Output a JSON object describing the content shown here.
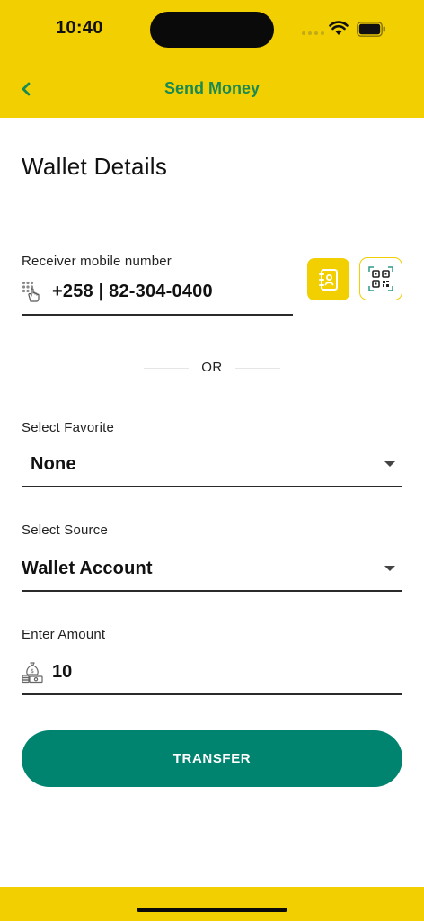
{
  "status_bar": {
    "time": "10:40"
  },
  "header": {
    "title": "Send Money",
    "back_icon": "chevron-left-icon"
  },
  "page": {
    "title": "Wallet Details"
  },
  "receiver": {
    "label": "Receiver mobile number",
    "value": "+258 | 82-304-0400",
    "contacts_icon": "contacts-book-icon",
    "qr_icon": "qr-scan-icon"
  },
  "divider": {
    "text": "OR"
  },
  "favorite": {
    "label": "Select Favorite",
    "value": "None"
  },
  "source": {
    "label": "Select Source",
    "value": "Wallet Account"
  },
  "amount": {
    "label": "Enter Amount",
    "value": "10"
  },
  "actions": {
    "transfer_label": "TRANSFER"
  },
  "colors": {
    "brand_yellow": "#f2cf00",
    "brand_green": "#008470",
    "title_green": "#1a8a52"
  }
}
